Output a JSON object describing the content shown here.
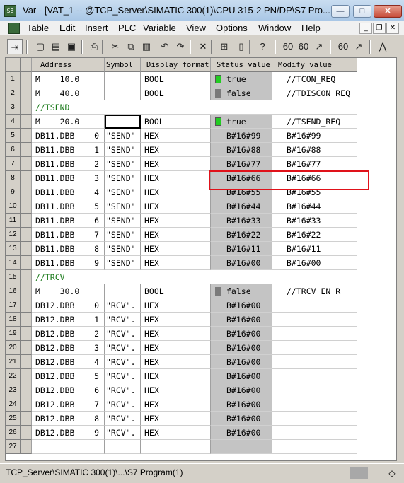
{
  "window": {
    "title": "Var - [VAT_1 -- @TCP_Server\\SIMATIC 300(1)\\CPU 315-2 PN/DP\\S7 Pro...",
    "app_icon_text": "S8"
  },
  "menu": [
    "Table",
    "Edit",
    "Insert",
    "PLC",
    "Variable",
    "View",
    "Options",
    "Window",
    "Help"
  ],
  "toolbar": {
    "icons": [
      "pin-icon",
      "new-icon",
      "open-icon",
      "save-icon",
      "print-icon",
      "cut-icon",
      "copy-icon",
      "paste-icon",
      "undo-icon",
      "redo-icon",
      "delete-icon",
      "monitor-icon",
      "plc-icon",
      "help-icon",
      "glasses-icon",
      "monitor-var-icon",
      "modify-var-icon",
      "trigger-icon",
      "force-icon",
      "online-icon"
    ],
    "glyphs": [
      "⇥",
      "▢",
      "▤",
      "▣",
      "⎙",
      "✂",
      "⧉",
      "▥",
      "↶",
      "↷",
      "✕",
      "⊞",
      "▯",
      "?",
      "60",
      "60",
      "↗",
      "60",
      "↗",
      "⋀"
    ]
  },
  "table": {
    "headers": {
      "address": "Address",
      "symbol": "Symbol",
      "display_format": "Display format",
      "status_value": "Status value",
      "modify_value": "Modify value"
    },
    "rows": [
      {
        "n": "1",
        "type": "data",
        "address": "M    10.0",
        "symbol": "",
        "format": "BOOL",
        "status": "true",
        "bit": "on",
        "modify": "//TCON_REQ"
      },
      {
        "n": "2",
        "type": "data",
        "address": "M    40.0",
        "symbol": "",
        "format": "BOOL",
        "status": "false",
        "bit": "off",
        "modify": "//TDISCON_REQ"
      },
      {
        "n": "3",
        "type": "comment",
        "text": "//TSEND"
      },
      {
        "n": "4",
        "type": "data",
        "address": "M    20.0",
        "symbol": "",
        "format": "BOOL",
        "status": "true",
        "bit": "on",
        "modify": "//TSEND_REQ",
        "selected_symbol": true
      },
      {
        "n": "5",
        "type": "data",
        "address": "DB11.DBB    0",
        "symbol": "\"SEND\"",
        "format": "HEX",
        "status": "B#16#99",
        "modify": "B#16#99"
      },
      {
        "n": "6",
        "type": "data",
        "address": "DB11.DBB    1",
        "symbol": "\"SEND\"",
        "format": "HEX",
        "status": "B#16#88",
        "modify": "B#16#88"
      },
      {
        "n": "7",
        "type": "data",
        "address": "DB11.DBB    2",
        "symbol": "\"SEND\"",
        "format": "HEX",
        "status": "B#16#77",
        "modify": "B#16#77"
      },
      {
        "n": "8",
        "type": "data",
        "address": "DB11.DBB    3",
        "symbol": "\"SEND\"",
        "format": "HEX",
        "status": "B#16#66",
        "modify": "B#16#66"
      },
      {
        "n": "9",
        "type": "data",
        "address": "DB11.DBB    4",
        "symbol": "\"SEND\"",
        "format": "HEX",
        "status": "B#16#55",
        "modify": "B#16#55"
      },
      {
        "n": "10",
        "type": "data",
        "address": "DB11.DBB    5",
        "symbol": "\"SEND\"",
        "format": "HEX",
        "status": "B#16#44",
        "modify": "B#16#44"
      },
      {
        "n": "11",
        "type": "data",
        "address": "DB11.DBB    6",
        "symbol": "\"SEND\"",
        "format": "HEX",
        "status": "B#16#33",
        "modify": "B#16#33"
      },
      {
        "n": "12",
        "type": "data",
        "address": "DB11.DBB    7",
        "symbol": "\"SEND\"",
        "format": "HEX",
        "status": "B#16#22",
        "modify": "B#16#22"
      },
      {
        "n": "13",
        "type": "data",
        "address": "DB11.DBB    8",
        "symbol": "\"SEND\"",
        "format": "HEX",
        "status": "B#16#11",
        "modify": "B#16#11"
      },
      {
        "n": "14",
        "type": "data",
        "address": "DB11.DBB    9",
        "symbol": "\"SEND\"",
        "format": "HEX",
        "status": "B#16#00",
        "modify": "B#16#00"
      },
      {
        "n": "15",
        "type": "comment",
        "text": "//TRCV"
      },
      {
        "n": "16",
        "type": "data",
        "address": "M    30.0",
        "symbol": "",
        "format": "BOOL",
        "status": "false",
        "bit": "off",
        "modify": "//TRCV_EN_R"
      },
      {
        "n": "17",
        "type": "data",
        "address": "DB12.DBB    0",
        "symbol": "\"RCV\".",
        "format": "HEX",
        "status": "B#16#00",
        "modify": ""
      },
      {
        "n": "18",
        "type": "data",
        "address": "DB12.DBB    1",
        "symbol": "\"RCV\".",
        "format": "HEX",
        "status": "B#16#00",
        "modify": ""
      },
      {
        "n": "19",
        "type": "data",
        "address": "DB12.DBB    2",
        "symbol": "\"RCV\".",
        "format": "HEX",
        "status": "B#16#00",
        "modify": ""
      },
      {
        "n": "20",
        "type": "data",
        "address": "DB12.DBB    3",
        "symbol": "\"RCV\".",
        "format": "HEX",
        "status": "B#16#00",
        "modify": ""
      },
      {
        "n": "21",
        "type": "data",
        "address": "DB12.DBB    4",
        "symbol": "\"RCV\".",
        "format": "HEX",
        "status": "B#16#00",
        "modify": ""
      },
      {
        "n": "22",
        "type": "data",
        "address": "DB12.DBB    5",
        "symbol": "\"RCV\".",
        "format": "HEX",
        "status": "B#16#00",
        "modify": ""
      },
      {
        "n": "23",
        "type": "data",
        "address": "DB12.DBB    6",
        "symbol": "\"RCV\".",
        "format": "HEX",
        "status": "B#16#00",
        "modify": ""
      },
      {
        "n": "24",
        "type": "data",
        "address": "DB12.DBB    7",
        "symbol": "\"RCV\".",
        "format": "HEX",
        "status": "B#16#00",
        "modify": ""
      },
      {
        "n": "25",
        "type": "data",
        "address": "DB12.DBB    8",
        "symbol": "\"RCV\".",
        "format": "HEX",
        "status": "B#16#00",
        "modify": ""
      },
      {
        "n": "26",
        "type": "data",
        "address": "DB12.DBB    9",
        "symbol": "\"RCV\".",
        "format": "HEX",
        "status": "B#16#00",
        "modify": ""
      },
      {
        "n": "27",
        "type": "empty"
      }
    ]
  },
  "statusbar": {
    "path": "TCP_Server\\SIMATIC 300(1)\\...\\S7 Program(1)"
  },
  "colors": {
    "bit_on": "#22cc22",
    "bit_off": "#7a7a7a",
    "highlight": "#e0121a",
    "comment": "#1a7a1a"
  }
}
